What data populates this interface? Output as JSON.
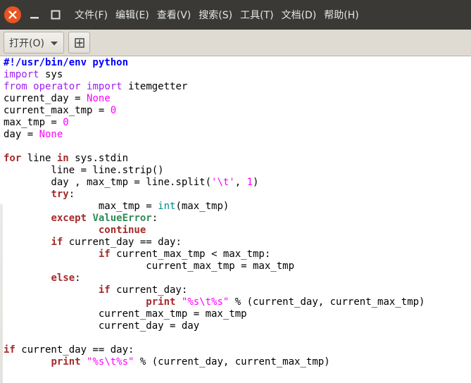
{
  "window": {
    "close_icon": "close-icon",
    "minimize_icon": "minimize-icon",
    "maximize_icon": "maximize-icon",
    "accent": "#e95420"
  },
  "menu": {
    "items": [
      "文件(F)",
      "编辑(E)",
      "查看(V)",
      "搜索(S)",
      "工具(T)",
      "文档(D)",
      "帮助(H)"
    ]
  },
  "toolbar": {
    "open_label": "打开(O)",
    "open_caret_icon": "chevron-down-icon",
    "new_tab_icon": "new-document-icon"
  },
  "editor": {
    "lines": [
      [
        {
          "t": "#!/usr/bin/env python",
          "c": "shebang"
        }
      ],
      [
        {
          "t": "import",
          "c": "kw2"
        },
        {
          "t": " sys",
          "c": ""
        }
      ],
      [
        {
          "t": "from",
          "c": "kw2"
        },
        {
          "t": " ",
          "c": ""
        },
        {
          "t": "operator",
          "c": "kw2"
        },
        {
          "t": " ",
          "c": ""
        },
        {
          "t": "import",
          "c": "kw2"
        },
        {
          "t": " itemgetter",
          "c": ""
        }
      ],
      [
        {
          "t": "current_day = ",
          "c": ""
        },
        {
          "t": "None",
          "c": "const"
        }
      ],
      [
        {
          "t": "current_max_tmp = ",
          "c": ""
        },
        {
          "t": "0",
          "c": "const"
        }
      ],
      [
        {
          "t": "max_tmp = ",
          "c": ""
        },
        {
          "t": "0",
          "c": "const"
        }
      ],
      [
        {
          "t": "day = ",
          "c": ""
        },
        {
          "t": "None",
          "c": "const"
        }
      ],
      [
        {
          "t": "",
          "c": ""
        }
      ],
      [
        {
          "t": "for",
          "c": "kwb"
        },
        {
          "t": " line ",
          "c": ""
        },
        {
          "t": "in",
          "c": "kwb"
        },
        {
          "t": " sys.stdin",
          "c": ""
        }
      ],
      [
        {
          "t": "        line = line.strip()",
          "c": ""
        }
      ],
      [
        {
          "t": "        day , max_tmp = line.split(",
          "c": ""
        },
        {
          "t": "'\\t'",
          "c": "str"
        },
        {
          "t": ", ",
          "c": ""
        },
        {
          "t": "1",
          "c": "const"
        },
        {
          "t": ")",
          "c": ""
        }
      ],
      [
        {
          "t": "        ",
          "c": ""
        },
        {
          "t": "try",
          "c": "kwb"
        },
        {
          "t": ":",
          "c": ""
        }
      ],
      [
        {
          "t": "                max_tmp = ",
          "c": ""
        },
        {
          "t": "int",
          "c": "builtin"
        },
        {
          "t": "(max_tmp)",
          "c": ""
        }
      ],
      [
        {
          "t": "        ",
          "c": ""
        },
        {
          "t": "except",
          "c": "kwb"
        },
        {
          "t": " ",
          "c": ""
        },
        {
          "t": "ValueError",
          "c": "exc"
        },
        {
          "t": ":",
          "c": ""
        }
      ],
      [
        {
          "t": "                ",
          "c": ""
        },
        {
          "t": "continue",
          "c": "kwb"
        }
      ],
      [
        {
          "t": "        ",
          "c": ""
        },
        {
          "t": "if",
          "c": "kwb"
        },
        {
          "t": " current_day == day:",
          "c": ""
        }
      ],
      [
        {
          "t": "                ",
          "c": ""
        },
        {
          "t": "if",
          "c": "kwb"
        },
        {
          "t": " current_max_tmp < max_tmp:",
          "c": ""
        }
      ],
      [
        {
          "t": "                        current_max_tmp = max_tmp",
          "c": ""
        }
      ],
      [
        {
          "t": "        ",
          "c": ""
        },
        {
          "t": "else",
          "c": "kwb"
        },
        {
          "t": ":",
          "c": ""
        }
      ],
      [
        {
          "t": "                ",
          "c": ""
        },
        {
          "t": "if",
          "c": "kwb"
        },
        {
          "t": " current_day:",
          "c": ""
        }
      ],
      [
        {
          "t": "                        ",
          "c": ""
        },
        {
          "t": "print",
          "c": "kwb"
        },
        {
          "t": " ",
          "c": ""
        },
        {
          "t": "\"%s\\t%s\"",
          "c": "str"
        },
        {
          "t": " % (current_day, current_max_tmp)",
          "c": ""
        }
      ],
      [
        {
          "t": "                current_max_tmp = max_tmp",
          "c": ""
        }
      ],
      [
        {
          "t": "                current_day = day",
          "c": ""
        }
      ],
      [
        {
          "t": "",
          "c": ""
        }
      ],
      [
        {
          "t": "if",
          "c": "kwb"
        },
        {
          "t": " current_day == day:",
          "c": ""
        }
      ],
      [
        {
          "t": "        ",
          "c": ""
        },
        {
          "t": "print",
          "c": "kwb"
        },
        {
          "t": " ",
          "c": ""
        },
        {
          "t": "\"%s\\t%s\"",
          "c": "str"
        },
        {
          "t": " % (current_day, current_max_tmp)",
          "c": ""
        }
      ]
    ]
  }
}
